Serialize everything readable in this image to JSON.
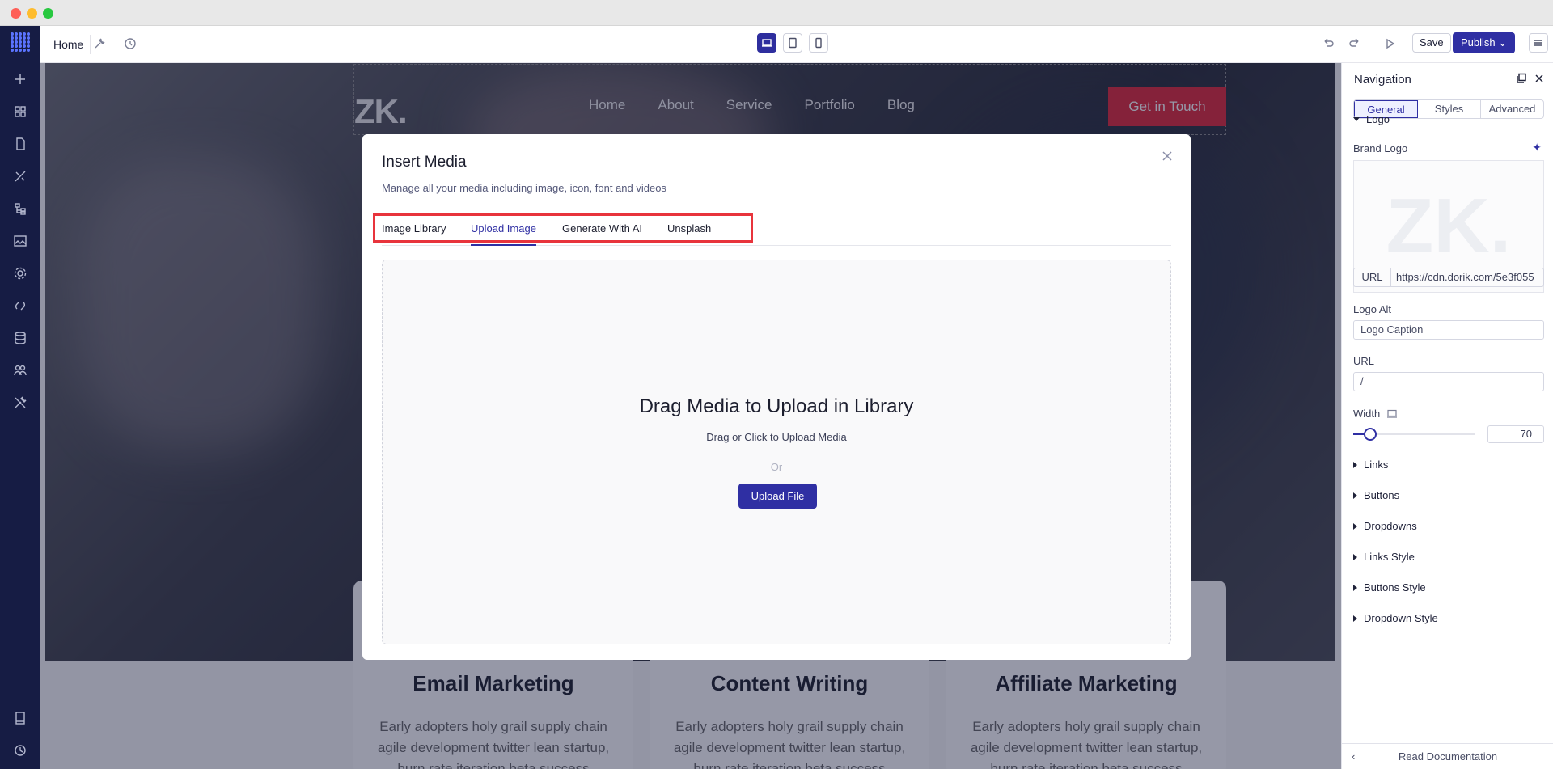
{
  "topbar": {
    "page_label": "Home",
    "save_label": "Save",
    "publish_label": "Publish"
  },
  "site": {
    "logo": "ZK.",
    "nav_links": [
      "Home",
      "About",
      "Service",
      "Portfolio",
      "Blog"
    ],
    "cta_label": "Get in Touch",
    "cards": [
      {
        "title": "Email Marketing",
        "body": "Early adopters holy grail supply chain agile development twitter lean startup, burn rate iteration beta success"
      },
      {
        "title": "Content Writing",
        "body": "Early adopters holy grail supply chain agile development twitter lean startup, burn rate iteration beta success"
      },
      {
        "title": "Affiliate Marketing",
        "body": "Early adopters holy grail supply chain agile development twitter lean startup, burn rate iteration beta success"
      }
    ]
  },
  "modal": {
    "title": "Insert Media",
    "subtitle": "Manage all your media including image, icon, font and videos",
    "tabs": [
      "Image Library",
      "Upload Image",
      "Generate With AI",
      "Unsplash"
    ],
    "active_tab": "Upload Image",
    "dropzone_title": "Drag Media to Upload in Library",
    "dropzone_subtitle": "Drag or Click to Upload Media",
    "dropzone_or": "Or",
    "upload_button": "Upload File"
  },
  "panel": {
    "title": "Navigation",
    "tabs": [
      "General",
      "Styles",
      "Advanced"
    ],
    "active_tab": "General",
    "logo_section": "Logo",
    "brand_logo_label": "Brand Logo",
    "url_tag": "URL",
    "logo_url": "https://cdn.dorik.com/5e3f055",
    "logo_alt_label": "Logo Alt",
    "logo_alt_value": "Logo Caption",
    "url_label": "URL",
    "url_value": "/",
    "width_label": "Width",
    "width_value": "70",
    "width_fraction": 0.14,
    "sections": [
      "Links",
      "Buttons",
      "Dropdowns",
      "Links Style",
      "Buttons Style",
      "Dropdown Style"
    ],
    "footer_label": "Read Documentation"
  },
  "colors": {
    "accent": "#2f2fa3",
    "cta": "#e0283a",
    "highlight": "#e8343c",
    "rail": "#161c44"
  }
}
